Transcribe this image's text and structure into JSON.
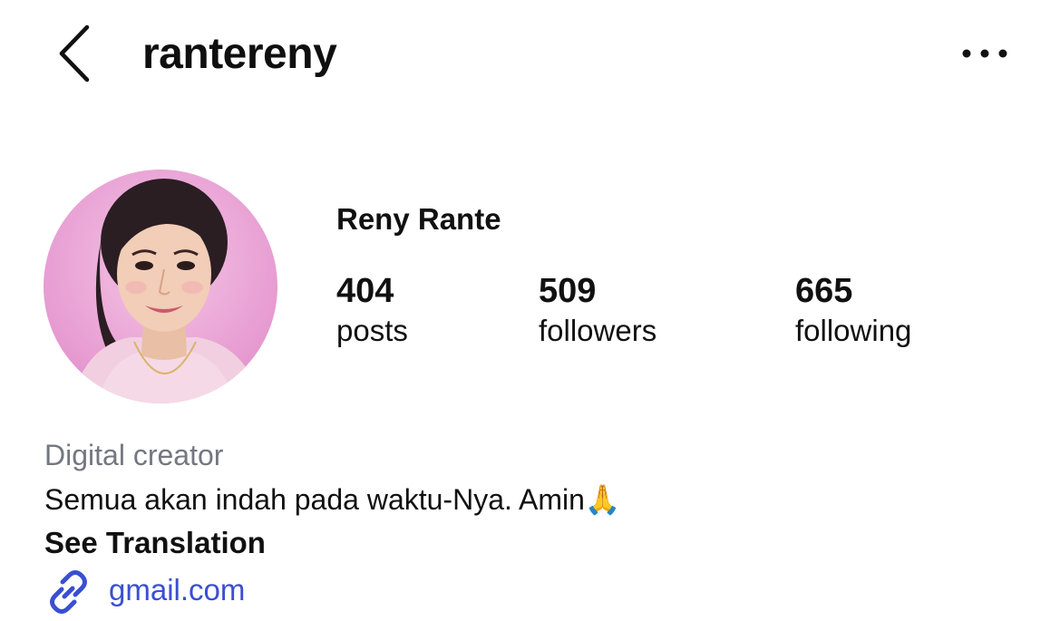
{
  "header": {
    "back_icon": "chevron-left-icon",
    "username": "rantereny",
    "more_icon": "more-horizontal-icon"
  },
  "profile": {
    "avatar_icon": "profile-photo",
    "display_name": "Reny Rante",
    "stats": {
      "posts": {
        "value": "404",
        "label": "posts"
      },
      "followers": {
        "value": "509",
        "label": "followers"
      },
      "following": {
        "value": "665",
        "label": "following"
      }
    },
    "category": "Digital creator",
    "bio": "Semua akan indah pada waktu-Nya. Amin🙏",
    "see_translation": "See Translation",
    "link": {
      "icon": "link-icon",
      "text": "gmail.com"
    }
  },
  "colors": {
    "text": "#111111",
    "muted": "#737780",
    "link": "#3a4fd1",
    "avatar_bg": "#e9a4d6"
  }
}
